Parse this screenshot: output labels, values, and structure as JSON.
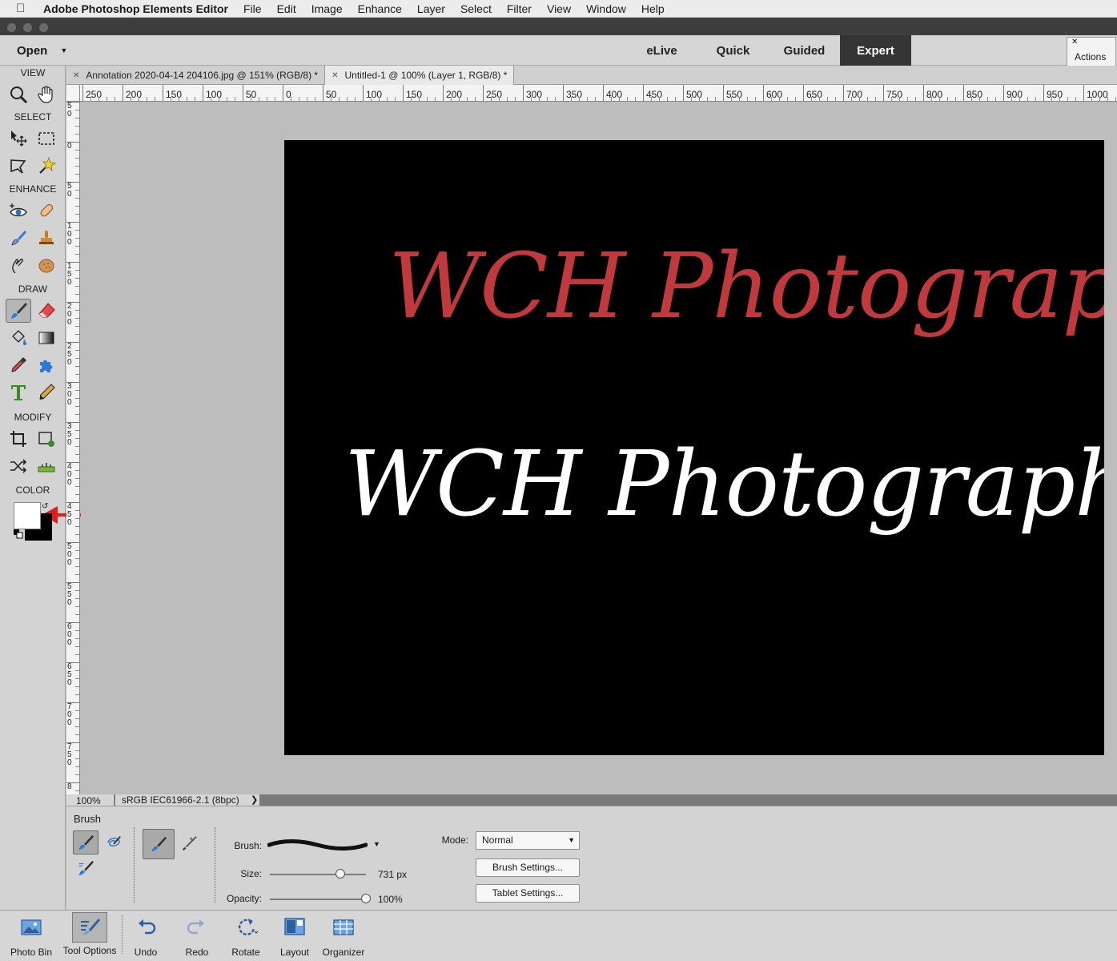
{
  "menubar": {
    "app_name": "Adobe Photoshop Elements Editor",
    "items": [
      "File",
      "Edit",
      "Image",
      "Enhance",
      "Layer",
      "Select",
      "Filter",
      "View",
      "Window",
      "Help"
    ]
  },
  "appbar": {
    "open_label": "Open",
    "modes": [
      {
        "label": "eLive",
        "active": false
      },
      {
        "label": "Quick",
        "active": false
      },
      {
        "label": "Guided",
        "active": false
      },
      {
        "label": "Expert",
        "active": true
      }
    ],
    "actions_label": "Actions"
  },
  "toolbox": {
    "sections": [
      "VIEW",
      "SELECT",
      "ENHANCE",
      "DRAW",
      "MODIFY",
      "COLOR"
    ],
    "tools": [
      {
        "name": "zoom-tool",
        "icon": "magnifier-icon"
      },
      {
        "name": "hand-tool",
        "icon": "hand-icon"
      },
      {
        "name": "move-tool",
        "icon": "move-arrow-icon"
      },
      {
        "name": "marquee-tool",
        "icon": "marquee-icon"
      },
      {
        "name": "lasso-tool",
        "icon": "lasso-icon"
      },
      {
        "name": "magic-wand-tool",
        "icon": "magic-wand-icon"
      },
      {
        "name": "red-eye-tool",
        "icon": "eye-icon"
      },
      {
        "name": "spot-healing-tool",
        "icon": "bandage-icon"
      },
      {
        "name": "smart-brush-tool",
        "icon": "smart-brush-icon"
      },
      {
        "name": "clone-stamp-tool",
        "icon": "stamp-icon"
      },
      {
        "name": "blur-tool",
        "icon": "finger-icon"
      },
      {
        "name": "sponge-tool",
        "icon": "sponge-icon"
      },
      {
        "name": "brush-tool",
        "icon": "brush-icon",
        "active": true
      },
      {
        "name": "eraser-tool",
        "icon": "eraser-icon"
      },
      {
        "name": "paint-bucket-tool",
        "icon": "bucket-icon"
      },
      {
        "name": "gradient-tool",
        "icon": "gradient-icon"
      },
      {
        "name": "eyedropper-tool",
        "icon": "eyedropper-icon"
      },
      {
        "name": "shape-tool",
        "icon": "puzzle-icon"
      },
      {
        "name": "type-tool",
        "icon": "type-icon"
      },
      {
        "name": "pencil-tool",
        "icon": "pencil-icon"
      },
      {
        "name": "crop-tool",
        "icon": "crop-icon"
      },
      {
        "name": "recompose-tool",
        "icon": "recompose-icon"
      },
      {
        "name": "content-aware-move-tool",
        "icon": "shuffle-icon"
      },
      {
        "name": "straighten-tool",
        "icon": "level-icon"
      }
    ],
    "foreground_color": "#ffffff",
    "background_color": "#000000"
  },
  "doc_tabs": [
    {
      "label": "Annotation 2020-04-14 204106.jpg @ 151% (RGB/8) *",
      "active": false
    },
    {
      "label": "Untitled-1 @ 100% (Layer 1, RGB/8) *",
      "active": true
    }
  ],
  "ruler": {
    "top_labels": [
      "250",
      "200",
      "150",
      "100",
      "50",
      "0",
      "50",
      "100",
      "150",
      "200",
      "250",
      "300",
      "350",
      "400",
      "450",
      "500",
      "550",
      "600",
      "650",
      "700",
      "750",
      "800",
      "850",
      "900",
      "950",
      "1000"
    ],
    "left_labels": [
      "50",
      "0",
      "50",
      "100",
      "150",
      "200",
      "250",
      "300",
      "350",
      "400",
      "450",
      "500",
      "550",
      "600",
      "650",
      "700",
      "750",
      "8"
    ]
  },
  "canvas": {
    "text_red": "WCH Photography",
    "text_white": "WCH Photography",
    "red_color": "#c0393d"
  },
  "status": {
    "zoom": "100%",
    "profile": "sRGB IEC61966-2.1 (8bpc)"
  },
  "tool_options": {
    "title": "Brush",
    "brush_label": "Brush:",
    "size_label": "Size:",
    "size_value": "731 px",
    "opacity_label": "Opacity:",
    "opacity_value": "100%",
    "mode_label": "Mode:",
    "mode_value": "Normal",
    "brush_settings": "Brush Settings...",
    "tablet_settings": "Tablet Settings..."
  },
  "taskbar": {
    "items": [
      "Photo Bin",
      "Tool Options",
      "Undo",
      "Redo",
      "Rotate",
      "Layout",
      "Organizer"
    ]
  }
}
